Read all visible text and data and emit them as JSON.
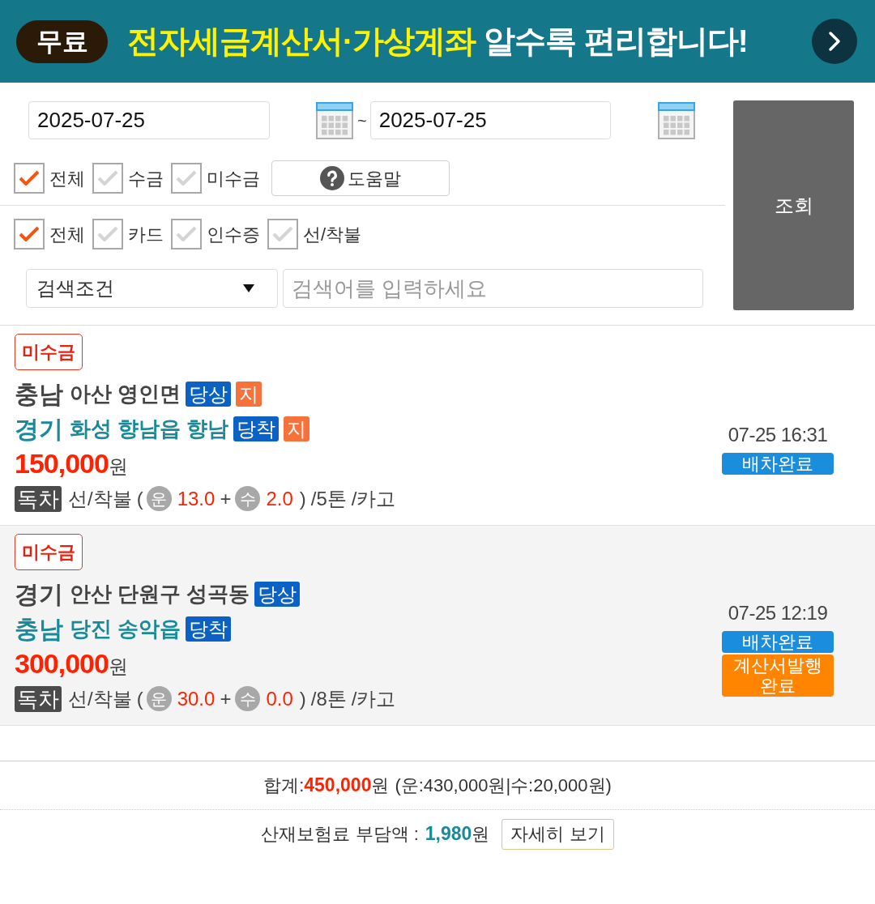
{
  "banner": {
    "badge": "무료",
    "highlight": "전자세금계산서·가상계좌",
    "text": "알수록 편리합니다!"
  },
  "search_form": {
    "date_from": "2025-07-25",
    "separator": "~",
    "date_to": "2025-07-25",
    "status_filters": [
      {
        "label": "전체",
        "checked": true
      },
      {
        "label": "수금",
        "checked": false
      },
      {
        "label": "미수금",
        "checked": false
      }
    ],
    "help_button": "도움말",
    "payment_filters": [
      {
        "label": "전체",
        "checked": true
      },
      {
        "label": "카드",
        "checked": false
      },
      {
        "label": "인수증",
        "checked": false
      },
      {
        "label": "선/착불",
        "checked": false
      }
    ],
    "condition_select": "검색조건",
    "keyword": {
      "placeholder": "검색어를 입력하세요"
    },
    "submit_button": "조회"
  },
  "orders": [
    {
      "tag": "미수금",
      "origin": {
        "province": "충남",
        "area": "아산 영인면",
        "badges": [
          {
            "label": "당상",
            "kind": "schedule"
          },
          {
            "label": "지",
            "kind": "extra"
          }
        ]
      },
      "destination": {
        "province": "경기",
        "area": "화성 향남읍 향남",
        "badges": [
          {
            "label": "당착",
            "kind": "schedule"
          },
          {
            "label": "지",
            "kind": "extra"
          }
        ]
      },
      "price": "150,000",
      "currency": "원",
      "vehicle": "독차",
      "payment": "선/착불",
      "open": "(",
      "fare_mark": "운",
      "fare": "13.0",
      "plus": "+",
      "fee_mark": "수",
      "fee": "2.0",
      "close": ")",
      "tonnage": "/5톤",
      "truck_type": "/카고",
      "datetime": "07-25 16:31",
      "statuses": [
        {
          "label": "배차완료",
          "kind": "dispatch"
        }
      ]
    },
    {
      "tag": "미수금",
      "origin": {
        "province": "경기",
        "area": "안산 단원구 성곡동",
        "badges": [
          {
            "label": "당상",
            "kind": "schedule"
          }
        ]
      },
      "destination": {
        "province": "충남",
        "area": "당진 송악읍",
        "badges": [
          {
            "label": "당착",
            "kind": "schedule"
          }
        ]
      },
      "price": "300,000",
      "currency": "원",
      "vehicle": "독차",
      "payment": "선/착불",
      "open": "(",
      "fare_mark": "운",
      "fare": "30.0",
      "plus": "+",
      "fee_mark": "수",
      "fee": "0.0",
      "close": ")",
      "tonnage": "/8톤",
      "truck_type": "/카고",
      "datetime": "07-25 12:19",
      "statuses": [
        {
          "label": "배차완료",
          "kind": "dispatch"
        },
        {
          "label": "계산서발행 완료",
          "kind": "invoice"
        }
      ]
    }
  ],
  "summary": {
    "label": "합계:",
    "total": "450,000",
    "currency": "원",
    "breakdown": "(운:430,000원|수:20,000원)"
  },
  "insurance": {
    "label": "산재보험료 부담액 :",
    "amount": "1,980",
    "currency": "원",
    "button": "자세히 보기"
  }
}
